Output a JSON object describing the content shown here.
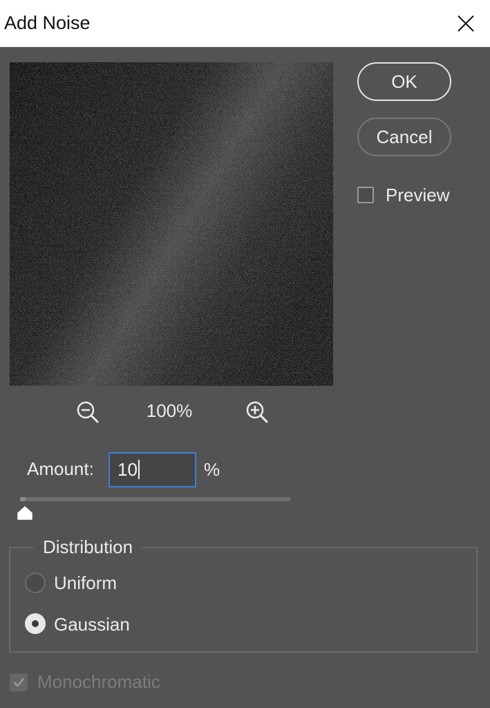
{
  "window": {
    "title": "Add Noise"
  },
  "actions": {
    "ok_label": "OK",
    "cancel_label": "Cancel"
  },
  "preview": {
    "label": "Preview",
    "checked": false
  },
  "zoom": {
    "level": "100%"
  },
  "amount": {
    "label": "Amount:",
    "value": "10",
    "unit": "%",
    "slider_fraction": 0.02
  },
  "distribution": {
    "legend": "Distribution",
    "options": [
      {
        "label": "Uniform",
        "selected": false
      },
      {
        "label": "Gaussian",
        "selected": true
      }
    ]
  },
  "monochromatic": {
    "label": "Monochromatic",
    "checked": true,
    "disabled": true
  },
  "colors": {
    "accent": "#3d7fd6",
    "background": "#535353",
    "titlebar": "#ffffff"
  }
}
